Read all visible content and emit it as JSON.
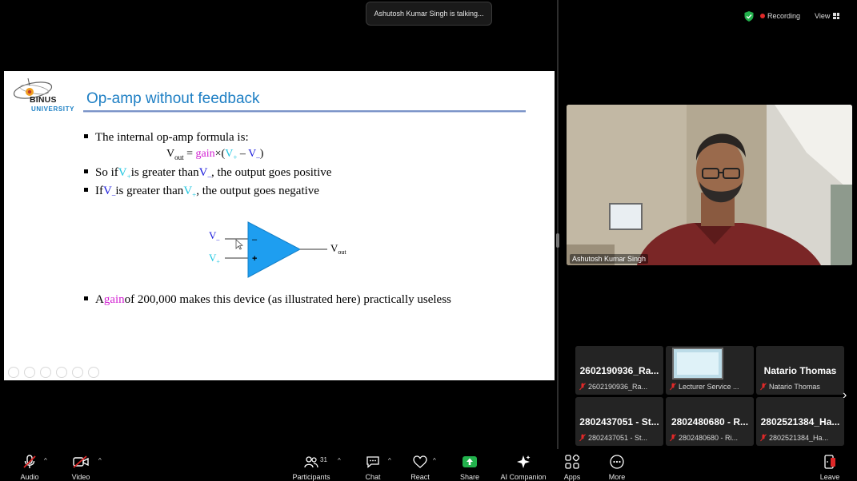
{
  "banner": {
    "talking": "Ashutosh Kumar Singh is talking..."
  },
  "status": {
    "recording": "Recording",
    "view": "View"
  },
  "colors": {
    "accent_blue": "#1e7fc4",
    "recording_red": "#e02828",
    "share_green": "#22b14c",
    "opamp_fill": "#1e9ef0",
    "mic_muted": "#e02828"
  },
  "slide": {
    "logo_name": "BINUS",
    "logo_sub": "UNIVERSITY",
    "title": "Op-amp without feedback",
    "bullet1": "The internal op-amp formula is:",
    "formula": {
      "v": "V",
      "out": "out",
      "eq": " = ",
      "gain": "gain",
      "times": "×(",
      "vplus": "V",
      "plus_sub": "+",
      "minus_op": " – ",
      "vminus": "V",
      "minus_sub": "–",
      "close": ")"
    },
    "bullet2": {
      "pre": "So if ",
      "v1": "V",
      "v1_sub": "+",
      "mid": " is greater than ",
      "v2": "V",
      "v2_sub": "–",
      "post": ", the output goes positive"
    },
    "bullet3": {
      "pre": "If ",
      "v1": "V",
      "v1_sub": "–",
      "mid": " is greater than ",
      "v2": "V",
      "v2_sub": "+",
      "post": ", the output goes negative"
    },
    "diagram": {
      "in_minus": "V",
      "in_minus_sub": "–",
      "in_plus": "V",
      "in_plus_sub": "+",
      "out": "V",
      "out_sub": "out",
      "minus_sign": "–",
      "plus_sign": "+"
    },
    "bullet4": {
      "pre": "A ",
      "gain": "gain",
      "post": " of 200,000 makes this device (as illustrated here) practically useless"
    }
  },
  "speaker": {
    "name": "Ashutosh Kumar Singh"
  },
  "gallery": [
    {
      "big": "2602190936_Ra...",
      "small": "2602190936_Ra..."
    },
    {
      "big": "",
      "small": "Lecturer Service ..."
    },
    {
      "big": "Natario Thomas",
      "small": "Natario Thomas"
    },
    {
      "big": "2802437051 - St...",
      "small": "2802437051 - St..."
    },
    {
      "big": "2802480680 - R...",
      "small": "2802480680 - Ri..."
    },
    {
      "big": "2802521384_Ha...",
      "small": "2802521384_Ha..."
    }
  ],
  "toolbar": {
    "audio": "Audio",
    "video": "Video",
    "participants": "Participants",
    "participants_count": "31",
    "chat": "Chat",
    "react": "React",
    "share": "Share",
    "ai": "AI Companion",
    "apps": "Apps",
    "more": "More",
    "leave": "Leave"
  }
}
